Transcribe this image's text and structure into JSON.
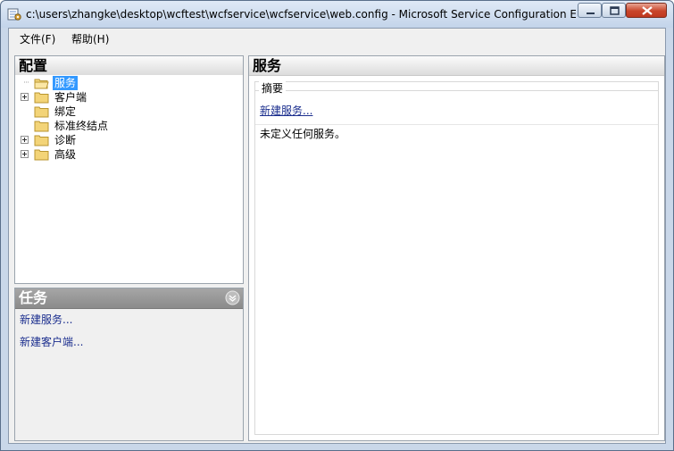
{
  "window": {
    "title": "c:\\users\\zhangke\\desktop\\wcftest\\wcfservice\\wcfservice\\web.config - Microsoft Service Configuration Ed...",
    "icons": {
      "app": "config-app-icon",
      "minimize": "minimize-icon",
      "maximize": "maximize-icon",
      "close": "close-icon"
    }
  },
  "menu": {
    "file": "文件(F)",
    "help": "帮助(H)"
  },
  "config_pane": {
    "title": "配置",
    "tree": [
      {
        "label": "服务",
        "selected": true,
        "expandable": false
      },
      {
        "label": "客户端",
        "selected": false,
        "expandable": true
      },
      {
        "label": "绑定",
        "selected": false,
        "expandable": false
      },
      {
        "label": "标准终结点",
        "selected": false,
        "expandable": false
      },
      {
        "label": "诊断",
        "selected": false,
        "expandable": true
      },
      {
        "label": "高级",
        "selected": false,
        "expandable": true
      }
    ]
  },
  "tasks_pane": {
    "title": "任务",
    "links": [
      "新建服务...",
      "新建客户端..."
    ]
  },
  "services_pane": {
    "title": "服务",
    "group_title": "摘要",
    "new_service_link": "新建服务...",
    "empty_message": "未定义任何服务。"
  },
  "colors": {
    "selection": "#3399ff",
    "link": "#1b2e8e",
    "close_button": "#c9452b"
  }
}
